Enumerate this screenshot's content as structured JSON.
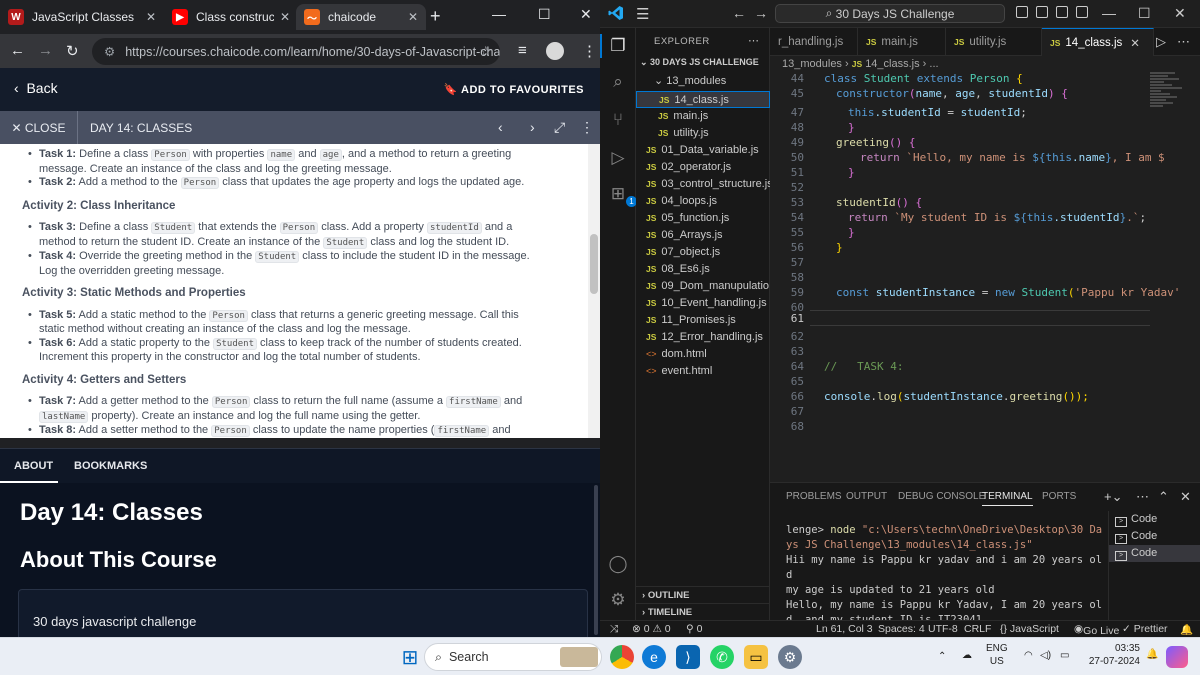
{
  "browser": {
    "tabs": [
      {
        "title": "JavaScript Classes",
        "icon_text": "W",
        "icon_color": "#b31b1b"
      },
      {
        "title": "Class constructor",
        "icon_text": "▶",
        "icon_color": "#ff0000"
      },
      {
        "title": "chaicode",
        "icon_text": "〜",
        "icon_color": "#f26b1d"
      }
    ],
    "url": "https://courses.chaicode.com/learn/home/30-days-of-Javascript-challe..."
  },
  "course_page": {
    "back_label": "Back",
    "favourite_label": "ADD TO FAVOURITES",
    "close_label": "CLOSE",
    "lesson_title": "DAY 14: CLASSES",
    "content": {
      "t1": {
        "label": "Task 1:",
        "a": " Define a class ",
        "c1": "Person",
        "b": " with properties ",
        "c2": "name",
        "c": " and ",
        "c3": "age",
        "d": ", and a method to return a greeting message. Create an instance of the class and log the greeting message."
      },
      "t2": {
        "label": "Task 2:",
        "a": " Add a method to the ",
        "c1": "Person",
        "b": " class that updates the age property and logs the updated age."
      },
      "h2": "Activity 2: Class Inheritance",
      "t3": {
        "label": "Task 3:",
        "a": " Define a class ",
        "c1": "Student",
        "b": " that extends the ",
        "c2": "Person",
        "c": " class. Add a property ",
        "c3": "studentId",
        "d": " and a method to return the student ID. Create an instance of the ",
        "c4": "Student",
        "e": " class and log the student ID."
      },
      "t4": {
        "label": "Task 4:",
        "a": " Override the greeting method in the ",
        "c1": "Student",
        "b": " class to include the student ID in the message. Log the overridden greeting message."
      },
      "h3": "Activity 3: Static Methods and Properties",
      "t5": {
        "label": "Task 5:",
        "a": " Add a static method to the ",
        "c1": "Person",
        "b": " class that returns a generic greeting message. Call this static method without creating an instance of the class and log the message."
      },
      "t6": {
        "label": "Task 6:",
        "a": " Add a static property to the ",
        "c1": "Student",
        "b": " class to keep track of the number of students created. Increment this property in the constructor and log the total number of students."
      },
      "h4": "Activity 4: Getters and Setters",
      "t7": {
        "label": "Task 7:",
        "a": " Add a getter method to the ",
        "c1": "Person",
        "b": " class to return the full name (assume a ",
        "c2": "firstName",
        "c": " and ",
        "c3": "lastName",
        "d": " property). Create an instance and log the full name using the getter."
      },
      "t8": {
        "label": "Task 8:",
        "a": " Add a setter method to the ",
        "c1": "Person",
        "b": " class to update the name properties (",
        "c2": "firstName",
        "c": " and ",
        "c3": "lastName"
      }
    },
    "tabs": [
      "ABOUT",
      "BOOKMARKS"
    ],
    "heading": "Day 14: Classes",
    "subheading": "About This Course",
    "course_name": "30 days javascript challenge"
  },
  "vscode": {
    "title": "30 Days JS Challenge",
    "explorer_label": "EXPLORER",
    "workspace": "30 DAYS JS CHALLENGE",
    "tree": [
      {
        "name": "13_modules",
        "type": "folder"
      },
      {
        "name": "14_class.js",
        "type": "js",
        "selected": true
      },
      {
        "name": "main.js",
        "type": "js"
      },
      {
        "name": "utility.js",
        "type": "js"
      },
      {
        "name": "01_Data_variable.js",
        "type": "js"
      },
      {
        "name": "02_operator.js",
        "type": "js"
      },
      {
        "name": "03_control_structure.js",
        "type": "js"
      },
      {
        "name": "04_loops.js",
        "type": "js"
      },
      {
        "name": "05_function.js",
        "type": "js"
      },
      {
        "name": "06_Arrays.js",
        "type": "js"
      },
      {
        "name": "07_object.js",
        "type": "js"
      },
      {
        "name": "08_Es6.js",
        "type": "js"
      },
      {
        "name": "09_Dom_manupulatio...",
        "type": "js"
      },
      {
        "name": "10_Event_handling.js",
        "type": "js"
      },
      {
        "name": "11_Promises.js",
        "type": "js"
      },
      {
        "name": "12_Error_handling.js",
        "type": "js"
      },
      {
        "name": "dom.html",
        "type": "html"
      },
      {
        "name": "event.html",
        "type": "html"
      }
    ],
    "outline_label": "OUTLINE",
    "timeline_label": "TIMELINE",
    "editor_tabs": [
      "r_handling.js",
      "main.js",
      "utility.js",
      "14_class.js"
    ],
    "breadcrumb": {
      "folder": "13_modules",
      "file": "14_class.js",
      "rest": "..."
    },
    "line_numbers": [
      "44",
      "45",
      "47",
      "48",
      "49",
      "50",
      "51",
      "52",
      "53",
      "54",
      "55",
      "56",
      "57",
      "58",
      "59",
      "60",
      "61",
      "62",
      "63",
      "64",
      "65",
      "66",
      "67",
      "68"
    ],
    "code": {
      "l44": {
        "kw": "class ",
        "cls": "Student",
        "kw2": " extends ",
        "cls2": "Person",
        "p": " {"
      },
      "l45": {
        "fn": "constructor",
        "p1": "(",
        "v1": "name",
        "c1": ", ",
        "v2": "age",
        "c2": ", ",
        "v3": "studentId",
        "p2": ") {"
      },
      "l47": {
        "kw": "this",
        "v": ".studentId",
        "p": " = ",
        "v2": "studentId",
        "p2": ";"
      },
      "l48": "}",
      "l49": {
        "fn": "greeting",
        "p": "() {"
      },
      "l50": {
        "kw": "return ",
        "s1": "`Hello, my name is ",
        "t1": "${",
        "k1": "this",
        "v1": ".name",
        "t2": "}",
        "s2": ", I am $"
      },
      "l51": "}",
      "l53": {
        "fn": "studentId",
        "p": "() {"
      },
      "l54": {
        "kw": "return ",
        "s1": "`My student ID is ",
        "t1": "${",
        "k1": "this",
        "v1": ".studentId",
        "t2": "}",
        "s2": ".`",
        "p": ";"
      },
      "l55": "}",
      "l56": "}",
      "l60": {
        "kw": "const ",
        "v": "studentInstance",
        "p": " = ",
        "kw2": "new ",
        "cls": "Student",
        "p2": "(",
        "s": "'Pappu kr Yadav'"
      },
      "l64": "//   TASK 4:",
      "l66": {
        "v": "console",
        "p": ".",
        "fn": "log",
        "p2": "(",
        "v2": "studentInstance",
        "p3": ".",
        "fn2": "greeting",
        "p4": "());"
      }
    },
    "panel_tabs": [
      "PROBLEMS",
      "OUTPUT",
      "DEBUG CONSOLE",
      "TERMINAL",
      "PORTS"
    ],
    "terminal": {
      "prompt": "lenge> ",
      "cmd": "node",
      "path": " \"c:\\Users\\techn\\OneDrive\\Desktop\\30 Da",
      "path2": "ys JS Challenge\\13_modules\\14_class.js\"",
      "out1": "Hii my name is Pappu kr yadav and i am 20 years ol",
      "out2": "d",
      "out3": "my age is updated to 21 years old",
      "out4": "Hello, my name is Pappu kr Yadav, I am 20 years ol",
      "out5": "d, and my student ID is IT23041."
    },
    "terminals": [
      "Code",
      "Code",
      "Code"
    ],
    "status": {
      "errors": "⊗ 0 ⚠ 0",
      "ports": "⚲ 0",
      "position": "Ln 61, Col 3",
      "spaces": "Spaces: 4",
      "encoding": "UTF-8",
      "eol": "CRLF",
      "language": "{} JavaScript",
      "golive": "Go Live",
      "prettier": "✓ Prettier"
    }
  },
  "taskbar": {
    "search_placeholder": "Search",
    "lang": "ENG",
    "region": "US",
    "time": "03:35",
    "date": "27-07-2024"
  }
}
